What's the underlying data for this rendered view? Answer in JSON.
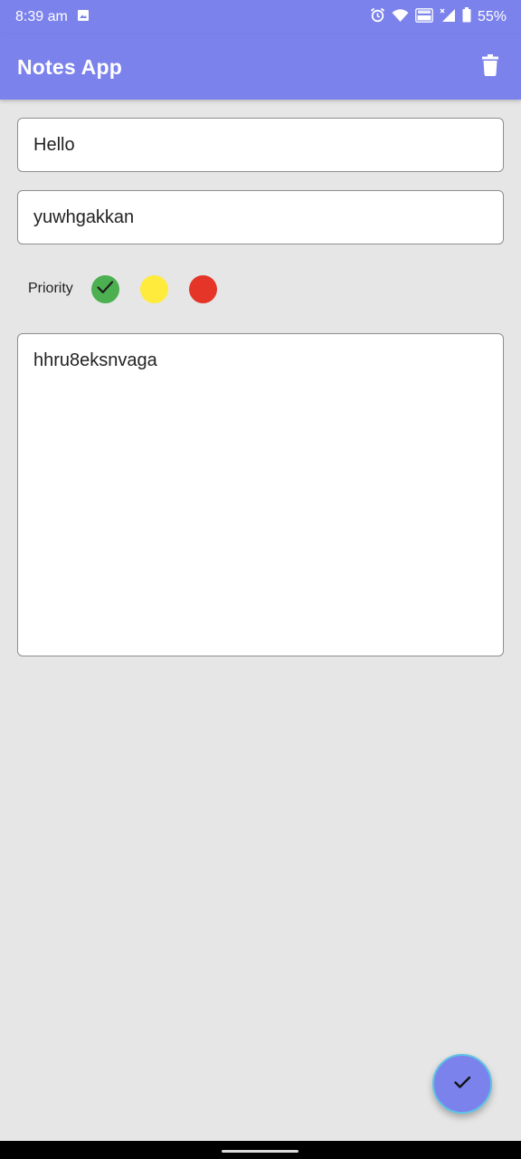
{
  "status_bar": {
    "time": "8:39 am",
    "battery": "55%",
    "icons": [
      "image-icon",
      "alarm-icon",
      "wifi-icon",
      "volte-icon",
      "signal-icon",
      "battery-icon"
    ]
  },
  "app_bar": {
    "title": "Notes App",
    "delete_icon": "trash-icon"
  },
  "form": {
    "title_value": "Hello",
    "subtitle_value": "yuwhgakkan",
    "priority_label": "Priority",
    "priorities": [
      {
        "name": "low",
        "color": "#4caf50",
        "selected": true
      },
      {
        "name": "medium",
        "color": "#ffeb3b",
        "selected": false
      },
      {
        "name": "high",
        "color": "#e53528",
        "selected": false
      }
    ],
    "body_value": "hhru8eksnvaga"
  },
  "fab": {
    "icon": "check-icon",
    "color": "#7b82eb"
  },
  "colors": {
    "primary": "#7b82eb",
    "background": "#e6e6e6"
  }
}
